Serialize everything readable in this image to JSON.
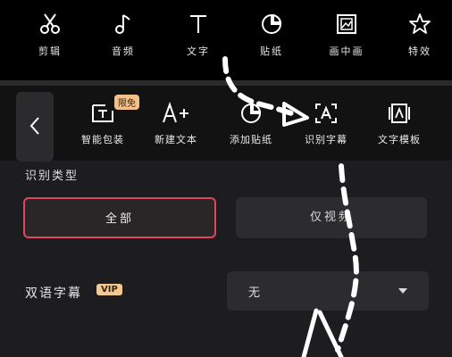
{
  "top_tools": [
    {
      "label": "剪辑",
      "icon": "scissors-icon"
    },
    {
      "label": "音频",
      "icon": "music-note-icon"
    },
    {
      "label": "文字",
      "icon": "text-icon"
    },
    {
      "label": "贴纸",
      "icon": "sticker-icon"
    },
    {
      "label": "画中画",
      "icon": "picture-in-picture-icon"
    },
    {
      "label": "特效",
      "icon": "effects-star-icon"
    }
  ],
  "sub_tools": [
    {
      "label": "智能包装",
      "icon": "smart-package-icon"
    },
    {
      "label": "新建文本",
      "icon": "new-text-icon"
    },
    {
      "label": "添加贴纸",
      "icon": "add-sticker-icon"
    },
    {
      "label": "识别字幕",
      "icon": "recognize-subtitle-icon"
    },
    {
      "label": "文字模板",
      "icon": "text-template-icon"
    }
  ],
  "badge_new": "限免",
  "panel": {
    "section_title": "识别类型",
    "option_all": "全部",
    "option_video_only": "仅视频",
    "bilingual_label": "双语字幕",
    "vip_badge": "VIP",
    "bilingual_value": "无"
  },
  "colors": {
    "accent": "#e0475e",
    "vip_gold": "#f2c995"
  }
}
